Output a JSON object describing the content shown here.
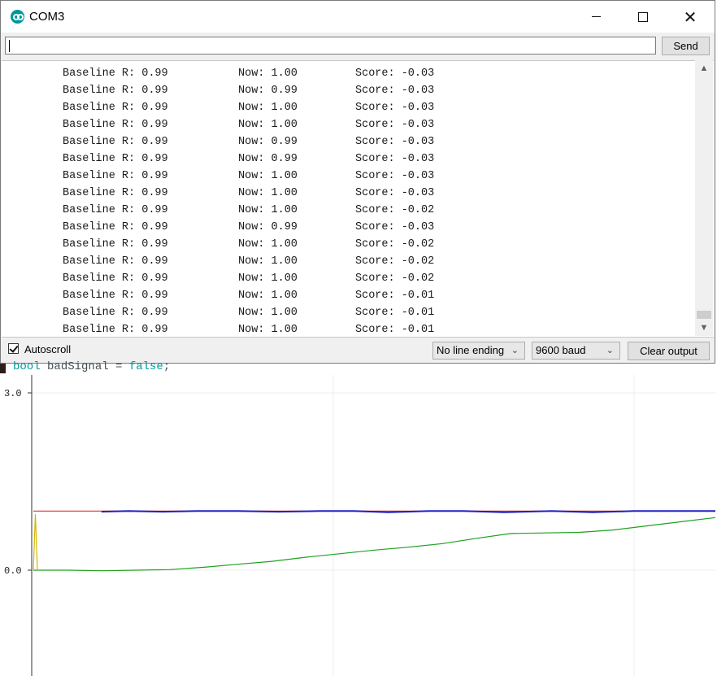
{
  "window": {
    "title": "COM3"
  },
  "send": {
    "input_value": "",
    "button_label": "Send"
  },
  "output": {
    "lines": [
      {
        "base": "Baseline R: 0.99",
        "now": "Now: 1.00",
        "score": "Score: -0.03"
      },
      {
        "base": "Baseline R: 0.99",
        "now": "Now: 0.99",
        "score": "Score: -0.03"
      },
      {
        "base": "Baseline R: 0.99",
        "now": "Now: 1.00",
        "score": "Score: -0.03"
      },
      {
        "base": "Baseline R: 0.99",
        "now": "Now: 1.00",
        "score": "Score: -0.03"
      },
      {
        "base": "Baseline R: 0.99",
        "now": "Now: 0.99",
        "score": "Score: -0.03"
      },
      {
        "base": "Baseline R: 0.99",
        "now": "Now: 0.99",
        "score": "Score: -0.03"
      },
      {
        "base": "Baseline R: 0.99",
        "now": "Now: 1.00",
        "score": "Score: -0.03"
      },
      {
        "base": "Baseline R: 0.99",
        "now": "Now: 1.00",
        "score": "Score: -0.03"
      },
      {
        "base": "Baseline R: 0.99",
        "now": "Now: 1.00",
        "score": "Score: -0.02"
      },
      {
        "base": "Baseline R: 0.99",
        "now": "Now: 0.99",
        "score": "Score: -0.03"
      },
      {
        "base": "Baseline R: 0.99",
        "now": "Now: 1.00",
        "score": "Score: -0.02"
      },
      {
        "base": "Baseline R: 0.99",
        "now": "Now: 1.00",
        "score": "Score: -0.02"
      },
      {
        "base": "Baseline R: 0.99",
        "now": "Now: 1.00",
        "score": "Score: -0.02"
      },
      {
        "base": "Baseline R: 0.99",
        "now": "Now: 1.00",
        "score": "Score: -0.01"
      },
      {
        "base": "Baseline R: 0.99",
        "now": "Now: 1.00",
        "score": "Score: -0.01"
      },
      {
        "base": "Baseline R: 0.99",
        "now": "Now: 1.00",
        "score": "Score: -0.01"
      }
    ]
  },
  "bottom": {
    "autoscroll_label": "Autoscroll",
    "autoscroll_checked": true,
    "line_ending_value": "No line ending",
    "baud_value": "9600 baud",
    "clear_label": "Clear output"
  },
  "code": {
    "kw_type": "bool",
    "identifier": " badSignal = ",
    "kw_value": "false",
    "end": ";"
  },
  "icons": [
    "arduino-icon",
    "minimize-icon",
    "maximize-icon",
    "close-icon",
    "scroll-up-icon",
    "scroll-down-icon",
    "dropdown-arrow-icon"
  ],
  "chart_data": {
    "type": "line",
    "ylim": [
      -2.0,
      3.0
    ],
    "y_ticks": [
      "3.0",
      "0.0"
    ],
    "xlim": [
      0,
      1
    ],
    "grid": true,
    "colors": {
      "red": "#e03030",
      "blue": "#2020c0",
      "green": "#20a020",
      "yellow": "#d4b800"
    },
    "series": [
      {
        "color": "red",
        "x": [
          0,
          1
        ],
        "y": [
          1.0,
          1.0
        ]
      },
      {
        "color": "blue",
        "x": [
          0.1,
          0.14,
          0.19,
          0.24,
          0.3,
          0.36,
          0.42,
          0.47,
          0.52,
          0.58,
          0.63,
          0.69,
          0.76,
          0.82,
          0.88,
          0.94,
          1.0
        ],
        "y": [
          0.99,
          1.0,
          0.99,
          1.0,
          1.0,
          0.99,
          1.0,
          1.0,
          0.98,
          1.0,
          1.0,
          0.98,
          1.0,
          0.98,
          1.0,
          1.0,
          1.0
        ]
      },
      {
        "color": "green",
        "x": [
          0,
          0.05,
          0.1,
          0.15,
          0.2,
          0.25,
          0.3,
          0.35,
          0.4,
          0.45,
          0.5,
          0.55,
          0.6,
          0.65,
          0.7,
          0.75,
          0.8,
          0.85,
          0.9,
          0.95,
          1.0
        ],
        "y": [
          0.0,
          0.0,
          -0.01,
          0.0,
          0.01,
          0.05,
          0.1,
          0.15,
          0.22,
          0.28,
          0.34,
          0.39,
          0.45,
          0.54,
          0.62,
          0.63,
          0.64,
          0.68,
          0.75,
          0.82,
          0.89
        ]
      },
      {
        "color": "yellow",
        "x": [
          0.0,
          0.003,
          0.006
        ],
        "y": [
          0.0,
          0.95,
          0.0
        ]
      }
    ]
  }
}
